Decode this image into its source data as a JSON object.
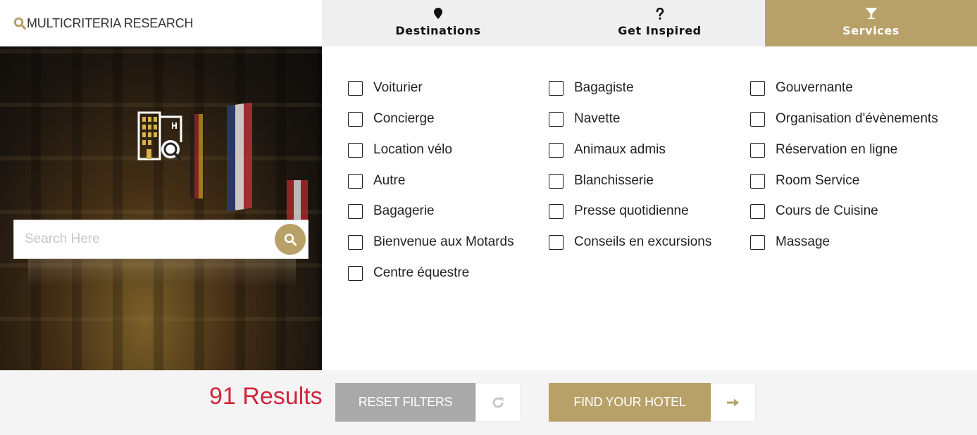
{
  "brand": {
    "title": "MULTICRITERIA RESEARCH",
    "icon": "search-icon",
    "accent_color": "#b8a169"
  },
  "tabs": [
    {
      "label": "Destinations",
      "icon": "map-marker-icon",
      "active": false
    },
    {
      "label": "Get Inspired",
      "icon": "question-icon",
      "active": false
    },
    {
      "label": "Services",
      "icon": "cocktail-glass-icon",
      "active": true
    }
  ],
  "hero": {
    "icon": "hotel-search-icon"
  },
  "search": {
    "placeholder": "Search Here",
    "value": "",
    "button_icon": "search-icon"
  },
  "services": {
    "columns": [
      [
        {
          "label": "Voiturier",
          "checked": false
        },
        {
          "label": "Concierge",
          "checked": false
        },
        {
          "label": "Location vélo",
          "checked": false
        },
        {
          "label": "Autre",
          "checked": false
        },
        {
          "label": "Bagagerie",
          "checked": false
        },
        {
          "label": "Bienvenue aux Motards",
          "checked": false
        },
        {
          "label": "Centre équestre",
          "checked": false
        }
      ],
      [
        {
          "label": "Bagagiste",
          "checked": false
        },
        {
          "label": "Navette",
          "checked": false
        },
        {
          "label": "Animaux admis",
          "checked": false
        },
        {
          "label": "Blanchisserie",
          "checked": false
        },
        {
          "label": "Presse quotidienne",
          "checked": false
        },
        {
          "label": "Conseils en excursions",
          "checked": false
        }
      ],
      [
        {
          "label": "Gouvernante",
          "checked": false
        },
        {
          "label": "Organisation d'évènements",
          "checked": false
        },
        {
          "label": "Réservation en ligne",
          "checked": false
        },
        {
          "label": "Room Service",
          "checked": false
        },
        {
          "label": "Cours de Cuisine",
          "checked": false
        },
        {
          "label": "Massage",
          "checked": false
        }
      ]
    ]
  },
  "footer": {
    "results_text": "91 Results",
    "results_color": "#d0253a",
    "reset_label": "RESET FILTERS",
    "refresh_icon": "refresh-icon",
    "find_label": "FIND YOUR HOTEL",
    "arrow_icon": "arrow-right-icon"
  }
}
